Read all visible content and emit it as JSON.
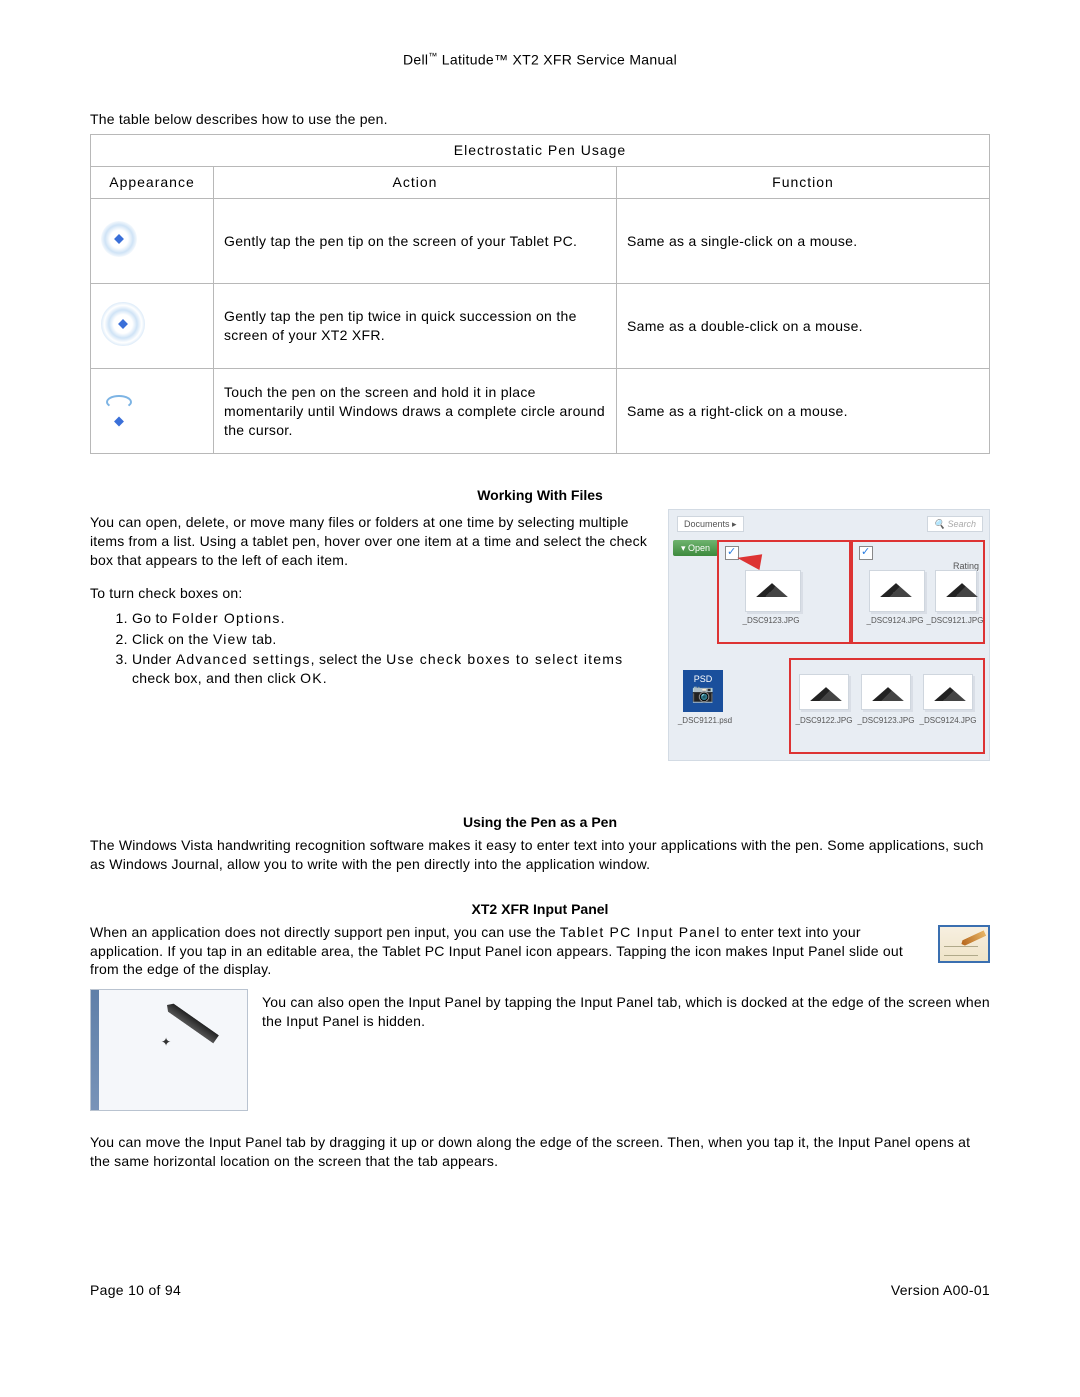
{
  "header": {
    "brand": "Dell",
    "tm1": "™",
    "product": " Latitude™ XT2 XFR Service Manual"
  },
  "intro": "The table below describes how to use the pen.",
  "table": {
    "title": "Electrostatic Pen Usage",
    "headers": {
      "appearance": "Appearance",
      "action": "Action",
      "function": "Function"
    },
    "rows": [
      {
        "action": "Gently tap the pen tip on the screen of your Tablet PC.",
        "function": "Same as a single-click on a mouse."
      },
      {
        "action": "Gently tap the pen tip twice in quick succession on the screen of your XT2 XFR.",
        "function": "Same as a double-click on a mouse."
      },
      {
        "action": "Touch the pen on the screen and hold it in place momentarily until Windows draws a complete circle around the cursor.",
        "function": "Same as a right-click on a mouse."
      }
    ]
  },
  "workingWithFiles": {
    "heading": "Working With Files",
    "p1": "You can open, delete, or move many files or folders at one time by selecting multiple items from a list. Using a tablet pen, hover over one item at a time and select the check box that appears to the left of each item.",
    "p2": "To turn check boxes on:",
    "steps": {
      "s1a": "Go to ",
      "s1b": "Folder Options",
      "s1c": ".",
      "s2a": "Click on the ",
      "s2b": "View",
      "s2c": " tab.",
      "s3a": "Under ",
      "s3b": "Advanced settings",
      "s3c": ", select the ",
      "s3d": "Use check boxes to select items",
      "s3e": " check box, and then click ",
      "s3f": "OK",
      "s3g": "."
    },
    "img": {
      "crumb": "Documents ▸",
      "search": "Search",
      "open": "Open",
      "rating": "Rating",
      "psd": "PSD",
      "f1": "_DSC9123.JPG",
      "f2": "_DSC9124.JPG",
      "f3": "_DSC9121.JPG",
      "f4": "_DSC9121.psd",
      "f5": "_DSC9122.JPG",
      "f6": "_DSC9123.JPG",
      "f7": "_DSC9124.JPG"
    }
  },
  "usingPen": {
    "heading": "Using the Pen as a Pen",
    "p1": "The Windows Vista handwriting recognition software makes it easy to enter text into your applications with the pen. Some applications, such as Windows Journal, allow you to write with the pen directly into the application window."
  },
  "inputPanel": {
    "heading": "XT2 XFR Input Panel",
    "p1a": "When an application does not directly support pen input, you can use the ",
    "p1b": "Tablet PC Input Panel",
    "p1c": " to enter text into your application. If you tap in an editable area, the Tablet PC Input Panel icon appears. Tapping the icon makes Input Panel slide out from the edge of the display.",
    "p2": "You can also open the Input Panel by tapping the Input Panel tab, which is docked at the edge of the screen when the Input Panel is hidden.",
    "p3": "You can move the Input Panel tab by dragging it up or down along the edge of the screen. Then, when you tap it, the Input Panel opens at the same horizontal location on the screen that the tab appears."
  },
  "footer": {
    "page": "Page 10 of 94",
    "version": "Version A00-01"
  }
}
